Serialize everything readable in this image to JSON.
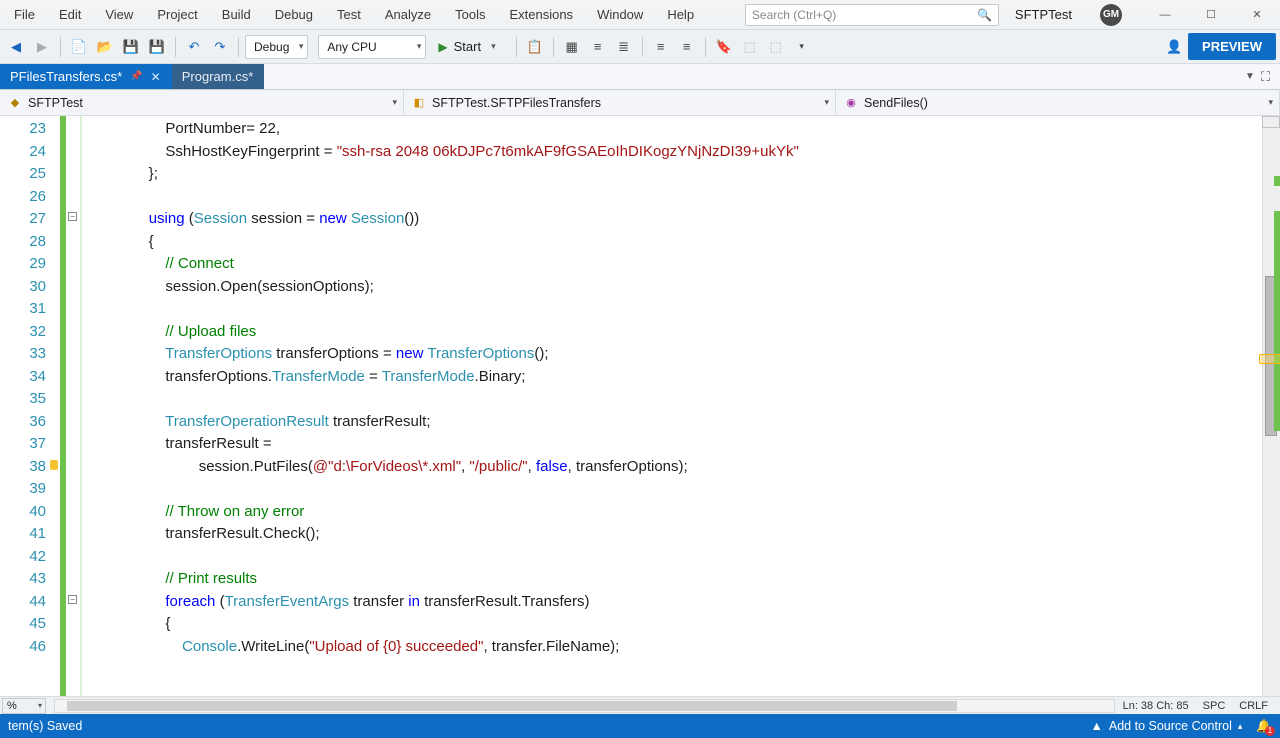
{
  "menus": [
    "File",
    "Edit",
    "View",
    "Project",
    "Build",
    "Debug",
    "Test",
    "Analyze",
    "Tools",
    "Extensions",
    "Window",
    "Help"
  ],
  "search": {
    "placeholder": "Search (Ctrl+Q)"
  },
  "solution_name": "SFTPTest",
  "avatar_initials": "GM",
  "toolbar": {
    "config": "Debug",
    "platform": "Any CPU",
    "start": "Start",
    "preview": "PREVIEW"
  },
  "tabs": [
    {
      "label": "PFilesTransfers.cs*",
      "active": true,
      "pinned": true
    },
    {
      "label": "Program.cs*",
      "active": false,
      "pinned": false
    }
  ],
  "nav": {
    "project": "SFTPTest",
    "class": "SFTPTest.SFTPFilesTransfers",
    "member": "SendFiles()"
  },
  "chart_data": {
    "type": "table",
    "title": "Code editor visible lines",
    "columns": [
      "line",
      "text"
    ],
    "rows": [
      [
        23,
        "                    PortNumber= 22,"
      ],
      [
        24,
        "                    SshHostKeyFingerprint = \"ssh-rsa 2048 06kDJPc7t6mkAF9fGSAEoIhDIKogzYNjNzDI39+ukYk\""
      ],
      [
        25,
        "                };"
      ],
      [
        26,
        ""
      ],
      [
        27,
        "                using (Session session = new Session())"
      ],
      [
        28,
        "                {"
      ],
      [
        29,
        "                    // Connect"
      ],
      [
        30,
        "                    session.Open(sessionOptions);"
      ],
      [
        31,
        ""
      ],
      [
        32,
        "                    // Upload files"
      ],
      [
        33,
        "                    TransferOptions transferOptions = new TransferOptions();"
      ],
      [
        34,
        "                    transferOptions.TransferMode = TransferMode.Binary;"
      ],
      [
        35,
        ""
      ],
      [
        36,
        "                    TransferOperationResult transferResult;"
      ],
      [
        37,
        "                    transferResult ="
      ],
      [
        38,
        "                            session.PutFiles(@\"d:\\ForVideos\\*.xml\", \"/public/\", false, transferOptions);"
      ],
      [
        39,
        ""
      ],
      [
        40,
        "                    // Throw on any error"
      ],
      [
        41,
        "                    transferResult.Check();"
      ],
      [
        42,
        ""
      ],
      [
        43,
        "                    // Print results"
      ],
      [
        44,
        "                    foreach (TransferEventArgs transfer in transferResult.Transfers)"
      ],
      [
        45,
        "                    {"
      ],
      [
        46,
        "                        Console.WriteLine(\"Upload of {0} succeeded\", transfer.FileName);"
      ]
    ]
  },
  "editor_lines": {
    "first": 23,
    "last": 46,
    "edit_mark_line": 38
  },
  "zoom": "%",
  "caret": {
    "ln": 38,
    "ch": 85
  },
  "encoding_labels": {
    "spc": "SPC",
    "crlf": "CRLF"
  },
  "status": {
    "saved": "tem(s) Saved",
    "source_control": "Add to Source Control",
    "notifications": "1"
  }
}
